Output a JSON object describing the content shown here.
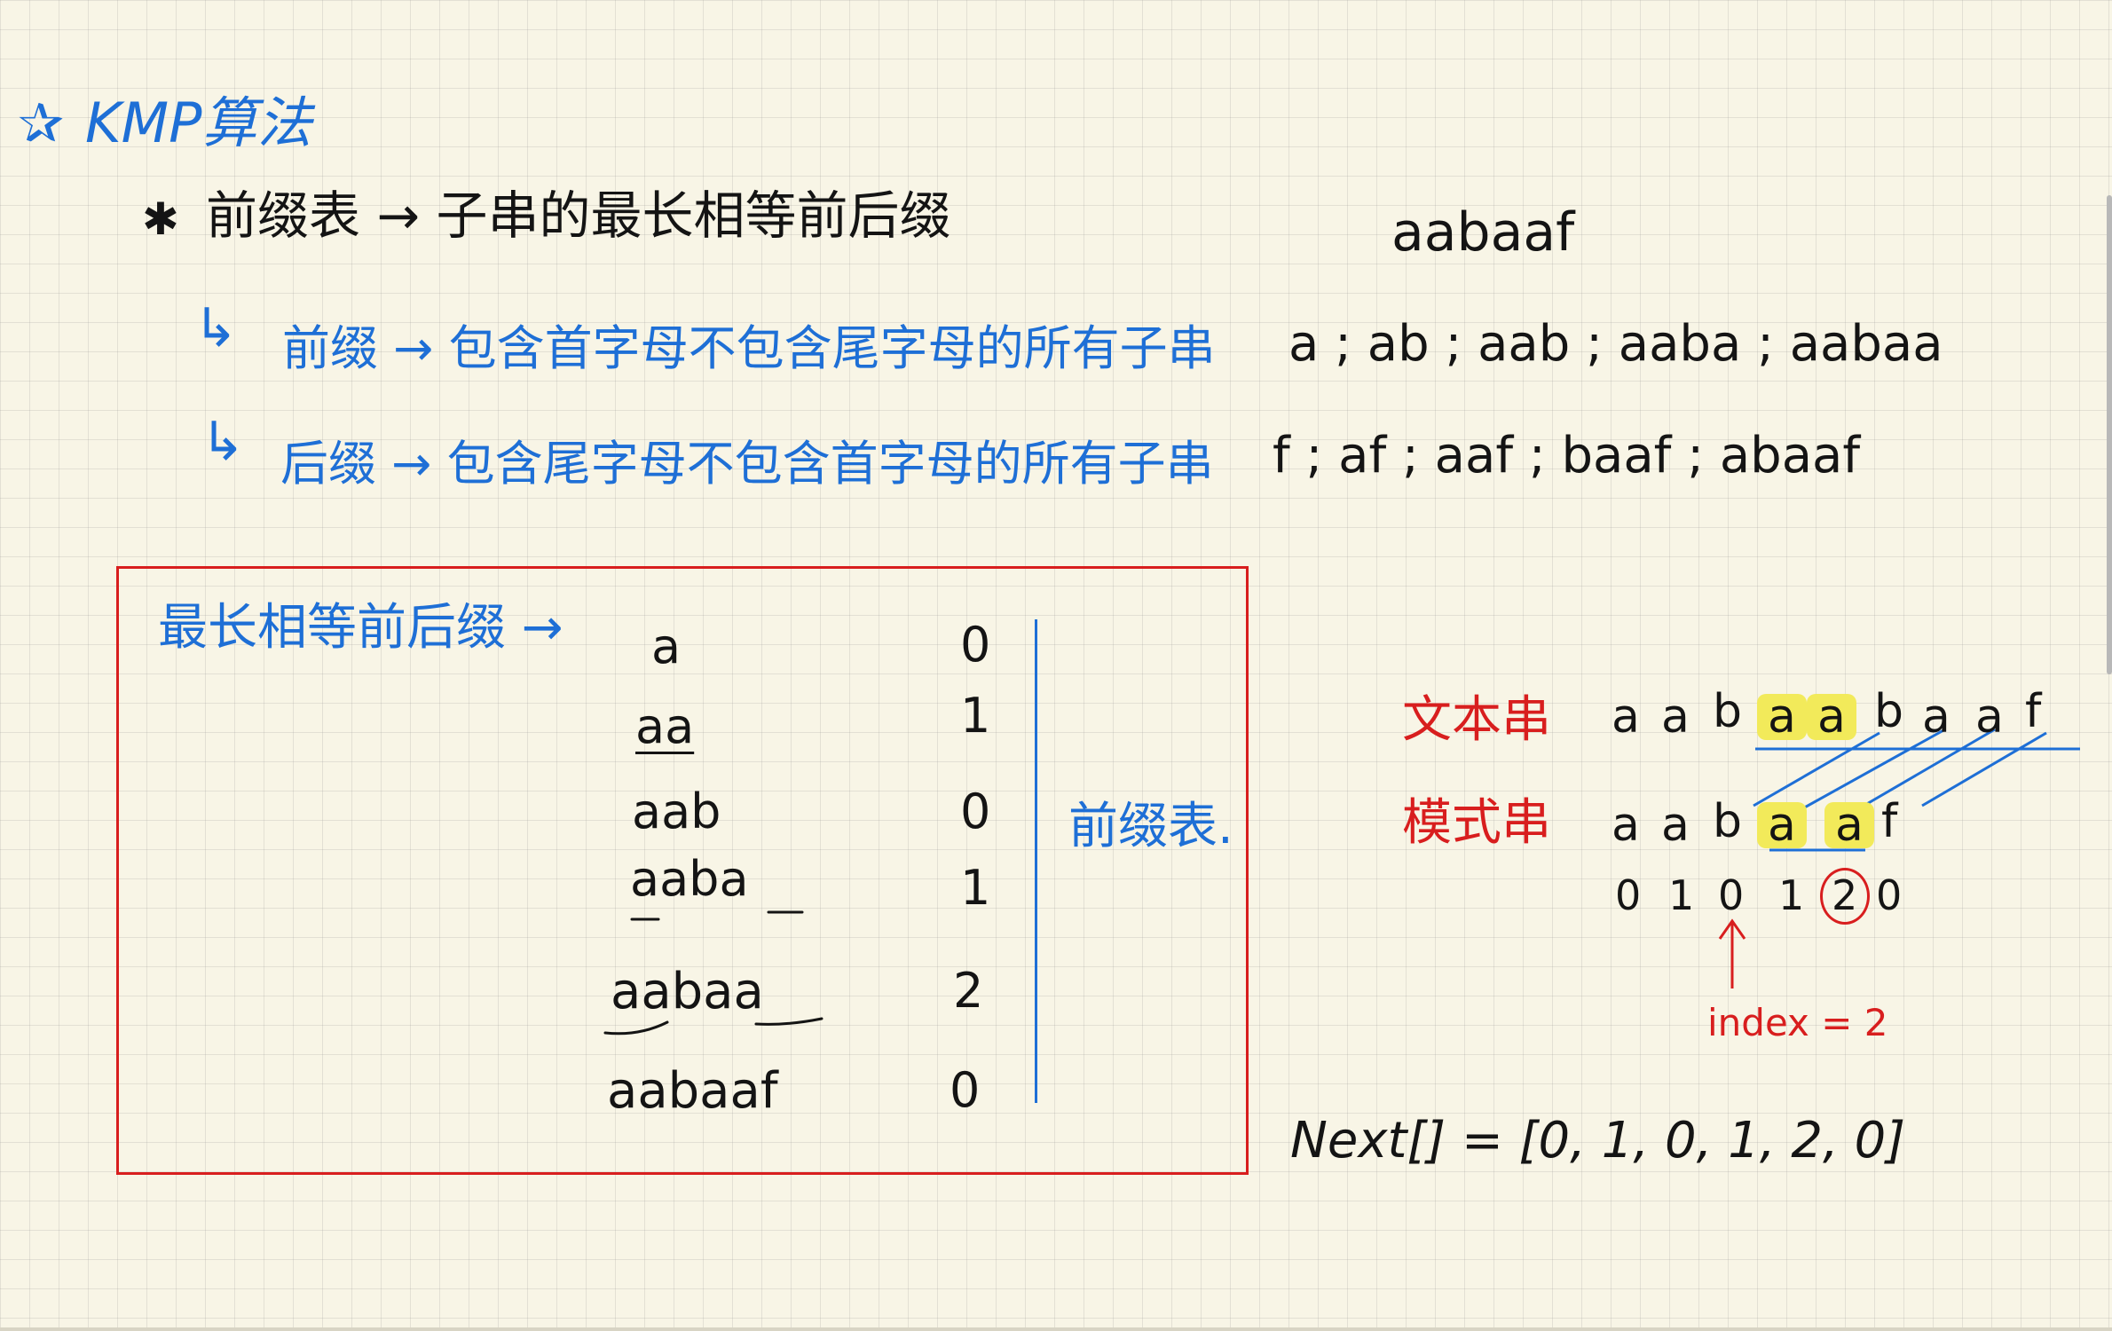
{
  "heading": {
    "star": "✰",
    "title": "KMP算法"
  },
  "prefix_table_line": {
    "star": "✱",
    "text": "前缀表 → 子串的最长相等前后缀"
  },
  "prefix_def": {
    "arrow": "↳",
    "text": "前缀 → 包含首字母不包含尾字母的所有子串",
    "examples": "a ; ab ; aab ; aaba ; aabaa"
  },
  "suffix_def": {
    "arrow": "↳",
    "text": "后缀 → 包含尾字母不包含首字母的所有子串",
    "examples": "f ; af ; aaf ; baaf ; abaaf"
  },
  "pattern": "aabaaf",
  "table": {
    "label": "最长相等前后缀 →",
    "rows": [
      {
        "sub": "a",
        "val": "0"
      },
      {
        "sub": "aa",
        "val": "1"
      },
      {
        "sub": "aab",
        "val": "0"
      },
      {
        "sub": "aaba",
        "val": "1"
      },
      {
        "sub": "aabaa",
        "val": "2"
      },
      {
        "sub": "aabaaf",
        "val": "0"
      }
    ],
    "side_label": "前缀表."
  },
  "matching": {
    "text_label": "文本串",
    "pattern_label": "模式串",
    "text_chars": [
      "a",
      "a",
      "b",
      "a",
      "a",
      "b",
      "a",
      "a",
      "f"
    ],
    "pattern_chars": [
      "a",
      "a",
      "b",
      "a",
      "a",
      "f"
    ],
    "next_values": [
      "0",
      "1",
      "0",
      "1",
      "2",
      "0"
    ],
    "index_note": "index = 2"
  },
  "next_array": "Next[] = [0, 1, 0, 1, 2, 0]"
}
